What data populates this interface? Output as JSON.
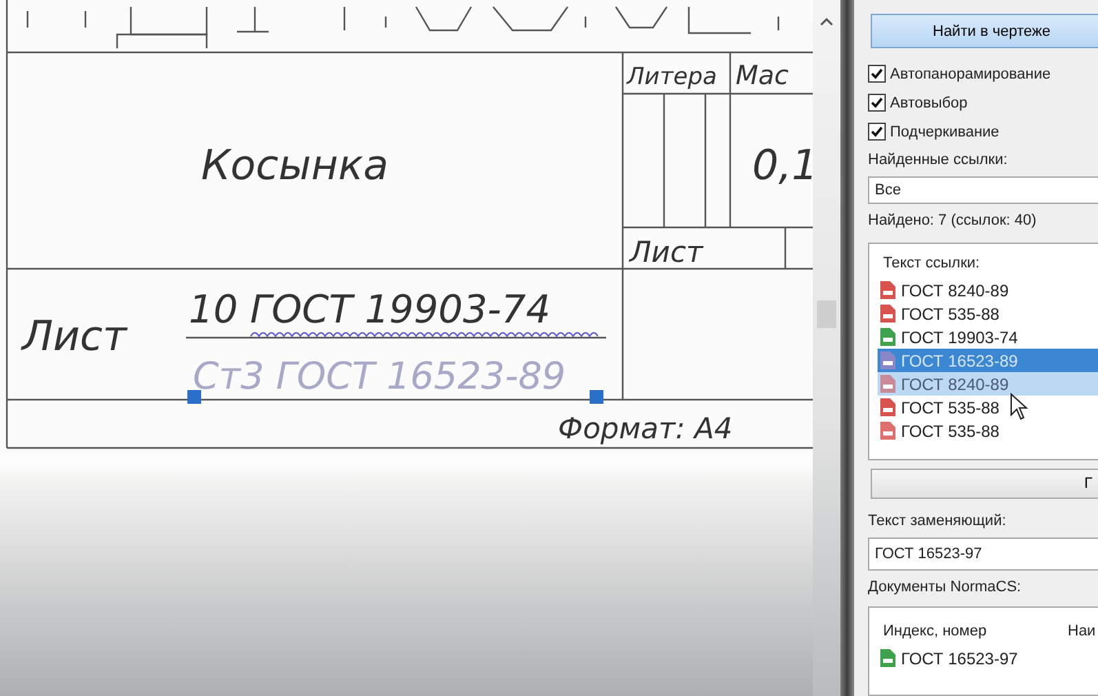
{
  "drawing": {
    "title_block": {
      "letter_header": "Литера",
      "scale_header": "Мас",
      "part_name": "Косынка",
      "scale_value": "0,1",
      "sheet_header": "Лист",
      "sheet_label": "Лист",
      "material_top": "10 ГОСТ 19903-74",
      "material_bottom": "Ст3 ГОСТ 16523-89",
      "format": "Формат: А4"
    }
  },
  "panel": {
    "find_button": "Найти в чертеже",
    "options": [
      {
        "label": "Автопанорамирование",
        "checked": true
      },
      {
        "label": "Автовыбор",
        "checked": true
      },
      {
        "label": "Подчеркивание",
        "checked": true
      }
    ],
    "found_label": "Найденные ссылки:",
    "filter": {
      "value": "Все"
    },
    "found_count": "Найдено: 7 (ссылок: 40)",
    "references": {
      "header": "Текст ссылки:",
      "items": [
        {
          "text": "ГОСТ 8240-89",
          "color": "#d9534f",
          "selected": false,
          "hovered": false
        },
        {
          "text": "ГОСТ 535-88",
          "color": "#d9534f",
          "selected": false,
          "hovered": false
        },
        {
          "text": "ГОСТ 19903-74",
          "color": "#3fa34d",
          "selected": false,
          "hovered": false
        },
        {
          "text": "ГОСТ 16523-89",
          "color": "#8a86c8",
          "selected": true,
          "hovered": false
        },
        {
          "text": "ГОСТ 8240-89",
          "color": "#c98a9a",
          "selected": false,
          "hovered": true
        },
        {
          "text": "ГОСТ 535-88",
          "color": "#d9534f",
          "selected": false,
          "hovered": false
        },
        {
          "text": "ГОСТ 535-88",
          "color": "#e07070",
          "selected": false,
          "hovered": false
        }
      ]
    },
    "replace_button": "Г",
    "replacement_label": "Текст заменяющий:",
    "replacement": {
      "value": "ГОСТ 16523-97"
    },
    "documents_label": "Документы NormaCS:",
    "documents": {
      "columns": [
        "Индекс, номер",
        "Наи"
      ],
      "items": [
        {
          "text": "ГОСТ 16523-97",
          "color": "#3fa34d"
        }
      ]
    }
  }
}
